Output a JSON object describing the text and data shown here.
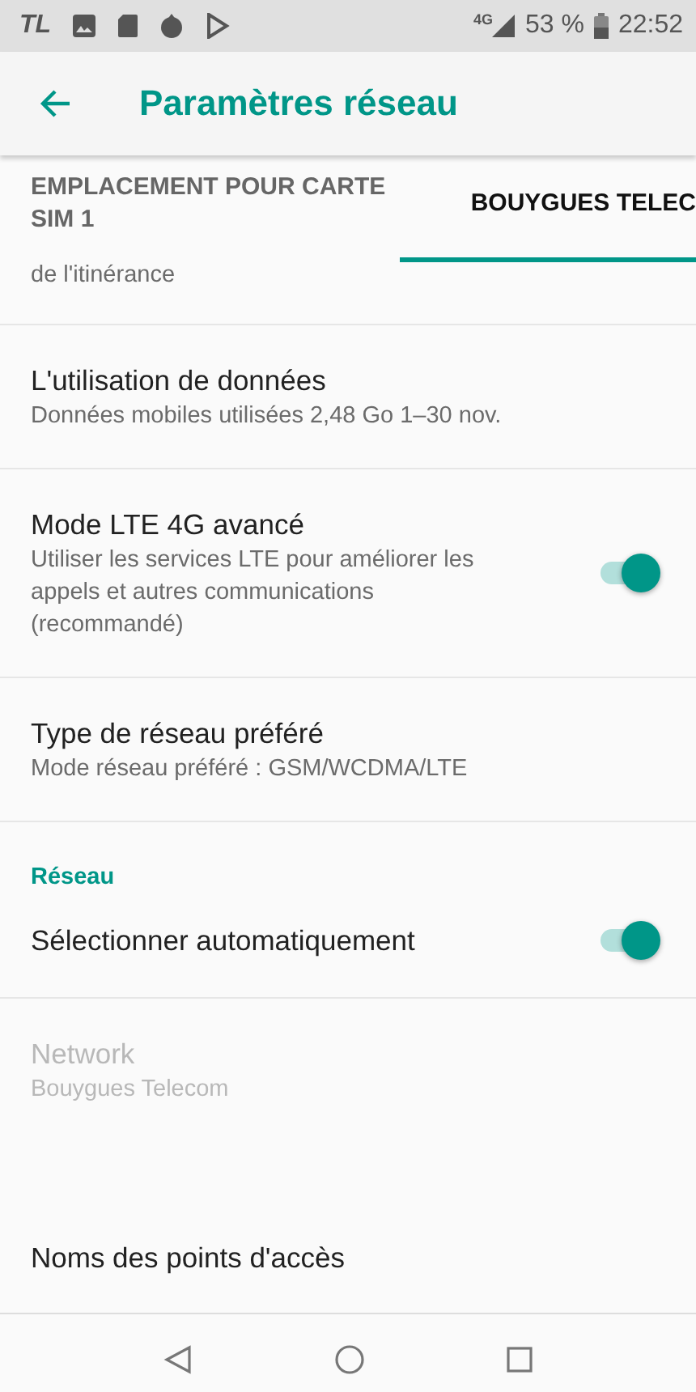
{
  "status_bar": {
    "left_text": "TL",
    "network": "4G",
    "battery": "53 %",
    "time": "22:52"
  },
  "app_bar": {
    "title": "Paramètres réseau"
  },
  "tabs": [
    {
      "label": "EMPLACEMENT POUR CARTE SIM 1",
      "selected": false
    },
    {
      "label": "BOUYGUES TELEC",
      "selected": true
    }
  ],
  "items": [
    {
      "kind": "fragment",
      "summary": "de l'itinérance"
    },
    {
      "kind": "text",
      "title": "L'utilisation de données",
      "summary": "Données mobiles utilisées 2,48 Go 1–30 nov.",
      "disabled": false
    },
    {
      "kind": "switch",
      "title": "Mode LTE 4G avancé",
      "summary": "Utiliser les services LTE pour améliorer les appels et autres communications (recommandé)",
      "on": true,
      "disabled": false
    },
    {
      "kind": "text",
      "title": "Type de réseau préféré",
      "summary": "Mode réseau préféré : GSM/WCDMA/LTE",
      "disabled": false
    },
    {
      "kind": "category",
      "title": "Réseau"
    },
    {
      "kind": "switch",
      "title": "Sélectionner automatiquement",
      "on": true,
      "disabled": false
    },
    {
      "kind": "text",
      "title": "Network",
      "summary": "Bouygues Telecom",
      "disabled": true
    },
    {
      "kind": "text",
      "title": "Noms des points d'accès",
      "disabled": false
    }
  ]
}
